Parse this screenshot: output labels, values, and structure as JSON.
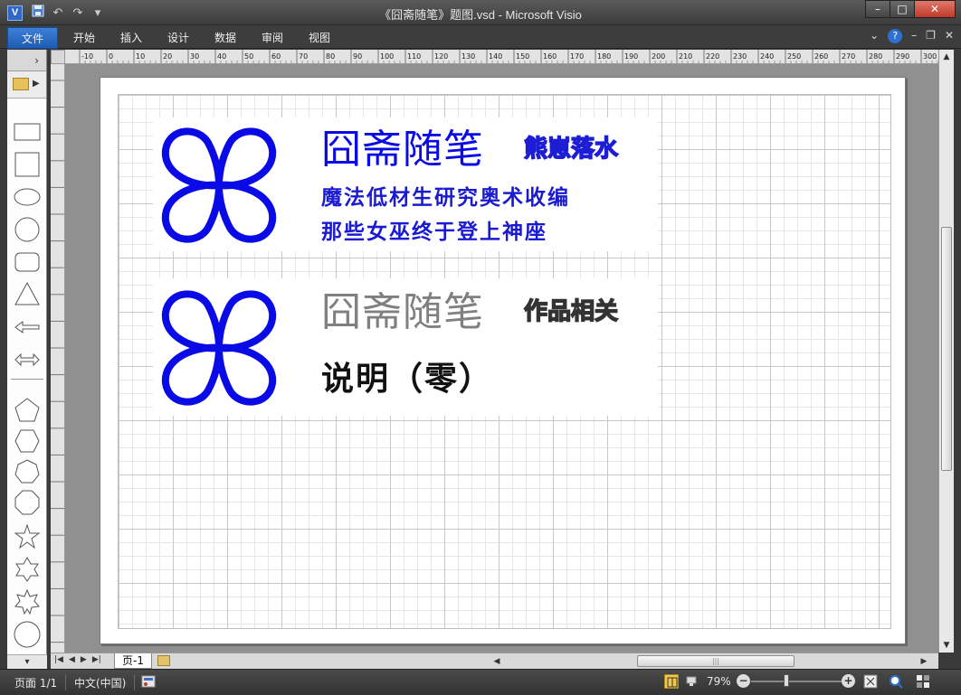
{
  "window": {
    "title": "《囧斋随笔》题图.vsd  -  Microsoft Visio",
    "app_icon_letter": "V",
    "controls": {
      "minimize": "–",
      "maximize": "□",
      "close": "✕"
    }
  },
  "quick_access": [
    "save-icon",
    "undo-icon",
    "redo-icon",
    "customize-icon"
  ],
  "ribbon": {
    "file_tab": "文件",
    "tabs": [
      "开始",
      "插入",
      "设计",
      "数据",
      "审阅",
      "视图"
    ]
  },
  "stencil": {
    "collapse_label": "›",
    "shapes": [
      "rectangle",
      "square",
      "ellipse",
      "circle",
      "rounded-rectangle",
      "triangle",
      "left-arrow",
      "double-arrow",
      "pentagon",
      "hexagon",
      "heptagon",
      "octagon",
      "star-5",
      "star-6",
      "star-7",
      "circle-large"
    ]
  },
  "rulers": {
    "horizontal": [
      "-10",
      "0",
      "10",
      "20",
      "30",
      "40",
      "50",
      "60",
      "70",
      "80",
      "90",
      "100",
      "110",
      "120",
      "130",
      "140",
      "150",
      "160",
      "170",
      "180",
      "190",
      "200",
      "210",
      "220",
      "230",
      "240",
      "250",
      "260",
      "270",
      "280",
      "290",
      "300"
    ],
    "vertical": [
      "210",
      "200",
      "190",
      "180",
      "170",
      "160",
      "150",
      "140",
      "130",
      "120",
      "110",
      "100",
      "90",
      "80",
      "70",
      "60",
      "50",
      "40",
      "30",
      "20",
      "10",
      "0"
    ]
  },
  "drawing": {
    "card1": {
      "brand": "囧斋随笔",
      "tag": "熊崽落水",
      "line1": "魔法低材生研究奥术收编",
      "line2": "那些女巫终于登上神座"
    },
    "card2": {
      "brand": "囧斋随笔",
      "tag": "作品相关",
      "title": "说明（零）"
    },
    "colors": {
      "blue": "#0a0ae6",
      "gray": "#808080",
      "black": "#111111"
    }
  },
  "page_tabs": {
    "current": "页-1"
  },
  "status": {
    "page": "页面 1/1",
    "language": "中文(中国)",
    "zoom": "79%",
    "zoom_level": 0.79
  }
}
